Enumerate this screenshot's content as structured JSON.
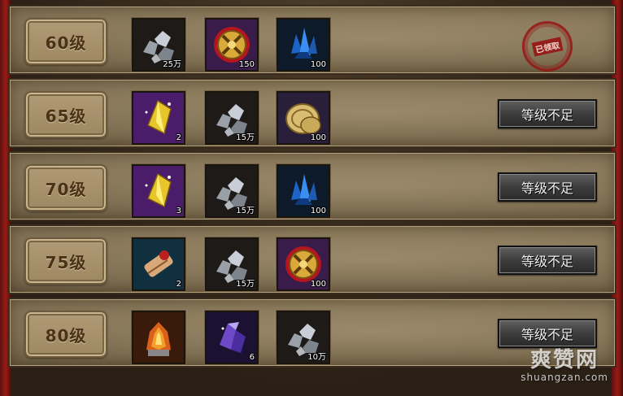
{
  "rows": [
    {
      "level": "60级",
      "items": [
        {
          "icon": "iron-ore-icon",
          "count": "25万"
        },
        {
          "icon": "gold-medal-icon",
          "count": "150"
        },
        {
          "icon": "blue-crystal-icon",
          "count": "100"
        }
      ],
      "status": "claimed",
      "stamp_text": "已领取"
    },
    {
      "level": "65级",
      "items": [
        {
          "icon": "gold-gem-icon",
          "count": "2"
        },
        {
          "icon": "iron-ore-icon",
          "count": "15万"
        },
        {
          "icon": "gold-coin-icon",
          "count": "100"
        }
      ],
      "status": "locked",
      "button_label": "等级不足"
    },
    {
      "level": "70级",
      "items": [
        {
          "icon": "gold-gem-icon",
          "count": "3"
        },
        {
          "icon": "iron-ore-icon",
          "count": "15万"
        },
        {
          "icon": "blue-crystal-icon",
          "count": "100"
        }
      ],
      "status": "locked",
      "button_label": "等级不足"
    },
    {
      "level": "75级",
      "items": [
        {
          "icon": "scroll-icon",
          "count": "2"
        },
        {
          "icon": "iron-ore-icon",
          "count": "15万"
        },
        {
          "icon": "gold-medal-icon",
          "count": "100"
        }
      ],
      "status": "locked",
      "button_label": "等级不足"
    },
    {
      "level": "80级",
      "items": [
        {
          "icon": "flame-stone-icon",
          "count": ""
        },
        {
          "icon": "purple-crystal-icon",
          "count": "6"
        },
        {
          "icon": "iron-ore-icon",
          "count": "10万"
        }
      ],
      "status": "locked",
      "button_label": "等级不足"
    }
  ],
  "watermark": {
    "main": "爽赞网",
    "sub": "shuangzan.com"
  },
  "colors": {
    "panel": "#867556",
    "button": "#3d3d3d",
    "stamp": "#961414"
  }
}
